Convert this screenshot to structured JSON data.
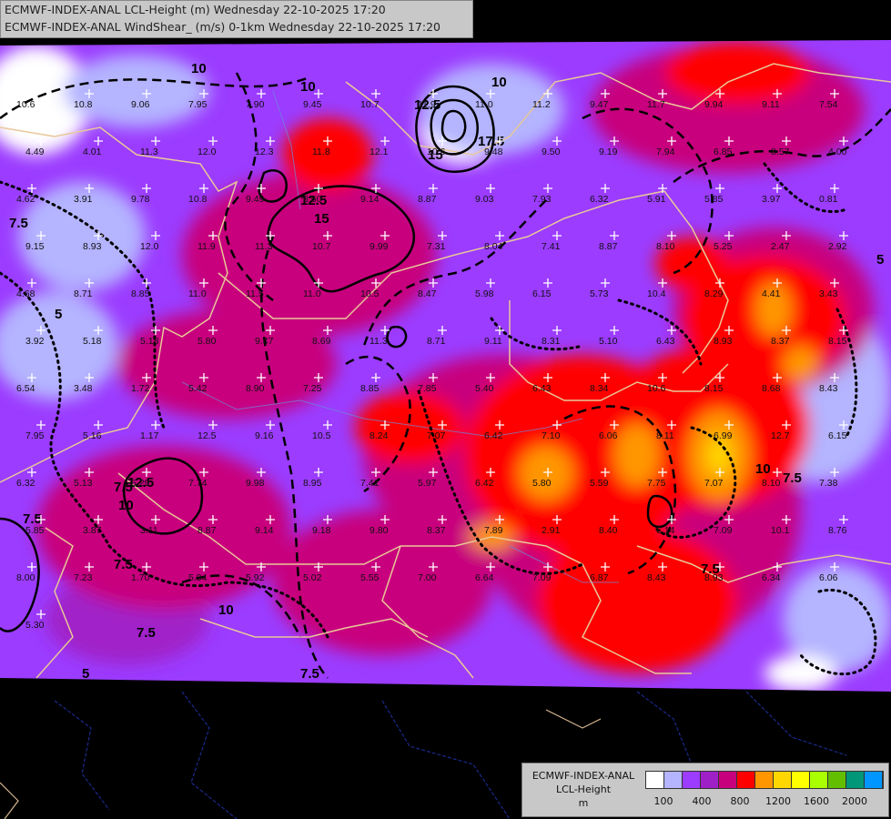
{
  "header": {
    "line1": "ECMWF-INDEX-ANAL LCL-Height (m) Wednesday 22-10-2025 17:20",
    "line2": "ECMWF-INDEX-ANAL WindShear_ (m/s) 0-1km Wednesday 22-10-2025 17:20"
  },
  "legend": {
    "title": "ECMWF-INDEX-ANAL",
    "subtitle": "LCL-Height",
    "unit": "m",
    "colors": [
      "#ffffff",
      "#b4b4ff",
      "#9b3cff",
      "#a020c8",
      "#c8007d",
      "#ff0000",
      "#ff9600",
      "#ffd700",
      "#ffff00",
      "#aaff00",
      "#64be00",
      "#009678",
      "#0096ff"
    ],
    "tick_labels": [
      "100",
      "400",
      "800",
      "1200",
      "1600",
      "2000"
    ]
  },
  "station_values": [
    "10.6",
    "10.8",
    "9.06",
    "7.95",
    "7.90",
    "9.45",
    "10.7",
    "11.9",
    "11.0",
    "11.2",
    "9.47",
    "11.7",
    "9.94",
    "9.11",
    "7.54",
    "4.49",
    "4.01",
    "11.3",
    "12.0",
    "12.3",
    "11.8",
    "12.1",
    "10.6",
    "9.48",
    "9.50",
    "9.19",
    "7.94",
    "6.85",
    "8.57",
    "4.00",
    "4.62",
    "3.91",
    "9.78",
    "10.8",
    "9.49",
    "8.60",
    "9.14",
    "8.87",
    "9.03",
    "7.93",
    "6.32",
    "5.91",
    "5.85",
    "3.97",
    "0.81",
    "9.15",
    "8.93",
    "12.0",
    "11.9",
    "11.3",
    "10.7",
    "9.99",
    "7.31",
    "8.04",
    "7.41",
    "8.87",
    "8.10",
    "5.25",
    "2.47",
    "2.92",
    "4.68",
    "8.71",
    "8.85",
    "11.0",
    "11.5",
    "11.0",
    "10.5",
    "8.47",
    "5.98",
    "6.15",
    "5.73",
    "10.4",
    "8.29",
    "4.41",
    "3.43",
    "3.92",
    "5.18",
    "5.18",
    "5.80",
    "9.47",
    "8.69",
    "11.3",
    "8.71",
    "9.11",
    "8.31",
    "5.10",
    "6.43",
    "8.93",
    "8.37",
    "8.15",
    "6.54",
    "3.48",
    "1.72",
    "5.42",
    "8.90",
    "7.25",
    "8.85",
    "7.85",
    "5.40",
    "6.43",
    "8.34",
    "10.6",
    "8.15",
    "8.68",
    "8.43",
    "7.95",
    "5.16",
    "1.17",
    "12.5",
    "9.16",
    "10.5",
    "8.24",
    "7.07",
    "6.42",
    "7.10",
    "6.06",
    "8.11",
    "6.99",
    "12.7",
    "6.15",
    "6.32",
    "5.13",
    "5.29",
    "7.74",
    "9.98",
    "8.95",
    "7.41",
    "5.97",
    "6.42",
    "5.80",
    "5.59",
    "7.75",
    "7.07",
    "8.10",
    "7.38",
    "5.85",
    "3.87",
    "3.11",
    "8.87",
    "9.14",
    "9.18",
    "9.80",
    "8.37",
    "7.89",
    "2.91",
    "8.40",
    "6.14",
    "7.09",
    "10.1",
    "8.76",
    "8.00",
    "7.23",
    "1.70",
    "5.94",
    "5.92",
    "5.02",
    "5.55",
    "7.00",
    "6.64",
    "7.09",
    "6.87",
    "8.43",
    "8.93",
    "6.34",
    "6.06",
    "5.30"
  ],
  "contour_labels": [
    "10",
    "10",
    "12.5",
    "15",
    "17.5",
    "10",
    "12.5",
    "15",
    "7.5",
    "5",
    "7.5",
    "10",
    "7.5",
    "12.5",
    "10",
    "7.5",
    "7.5",
    "7.5",
    "5",
    "7.5",
    "10",
    "7.5",
    "5"
  ]
}
